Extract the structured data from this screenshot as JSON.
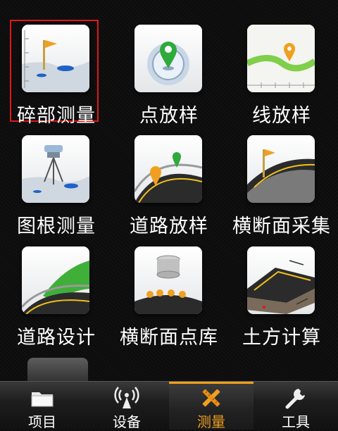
{
  "menu": {
    "items": [
      {
        "label": "碎部测量",
        "icon": "detail-survey-flag-icon",
        "selected": true
      },
      {
        "label": "点放样",
        "icon": "point-stakeout-pin-icon",
        "selected": false
      },
      {
        "label": "线放样",
        "icon": "line-stakeout-icon",
        "selected": false
      },
      {
        "label": "图根测量",
        "icon": "control-point-survey-icon",
        "selected": false
      },
      {
        "label": "道路放样",
        "icon": "road-stakeout-icon",
        "selected": false
      },
      {
        "label": "横断面采集",
        "icon": "cross-section-collect-icon",
        "selected": false
      },
      {
        "label": "道路设计",
        "icon": "road-design-icon",
        "selected": false
      },
      {
        "label": "横断面点库",
        "icon": "cross-section-point-db-icon",
        "selected": false
      },
      {
        "label": "土方计算",
        "icon": "earthwork-calc-icon",
        "selected": false
      }
    ]
  },
  "tabbar": {
    "tabs": [
      {
        "label": "项目",
        "icon": "folder-icon",
        "active": false
      },
      {
        "label": "设备",
        "icon": "antenna-icon",
        "active": false
      },
      {
        "label": "测量",
        "icon": "survey-tools-icon",
        "active": true
      },
      {
        "label": "工具",
        "icon": "wrench-icon",
        "active": false
      }
    ]
  },
  "colors": {
    "accent": "#f0a020",
    "selection": "#e01818",
    "background": "#0c0c0c"
  }
}
